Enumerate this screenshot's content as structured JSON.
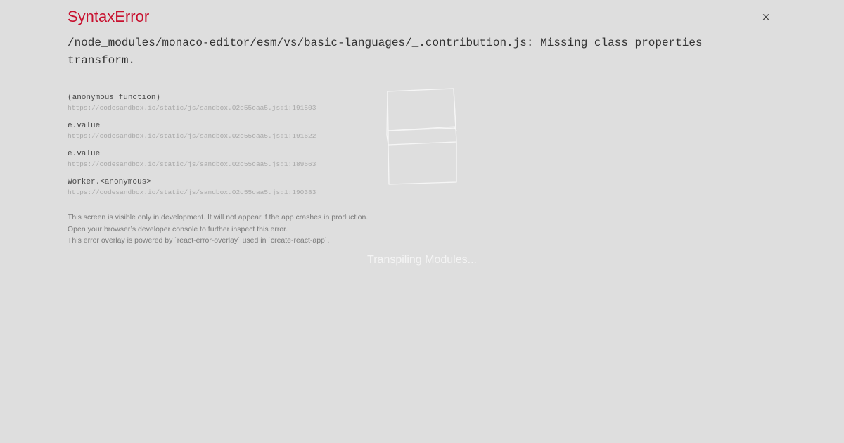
{
  "error": {
    "title": "SyntaxError",
    "close_label": "×",
    "message": "/node_modules/monaco-editor/esm/vs/basic-languages/_.contribution.js: Missing class properties transform."
  },
  "stack_frames": [
    {
      "function": "(anonymous function)",
      "location": "https://codesandbox.io/static/js/sandbox.02c55caa5.js:1:191503"
    },
    {
      "function": "e.value",
      "location": "https://codesandbox.io/static/js/sandbox.02c55caa5.js:1:191622"
    },
    {
      "function": "e.value",
      "location": "https://codesandbox.io/static/js/sandbox.02c55caa5.js:1:189663"
    },
    {
      "function": "Worker.<anonymous>",
      "location": "https://codesandbox.io/static/js/sandbox.02c55caa5.js:1:190383"
    }
  ],
  "footer_notes": [
    "This screen is visible only in development. It will not appear if the app crashes in production.",
    "Open your browser’s developer console to further inspect this error.",
    "This error overlay is powered by `react-error-overlay` used in `create-react-app`."
  ],
  "loading": {
    "text": "Transpiling Modules..."
  },
  "colors": {
    "background": "#dedede",
    "title": "#c8102e"
  }
}
